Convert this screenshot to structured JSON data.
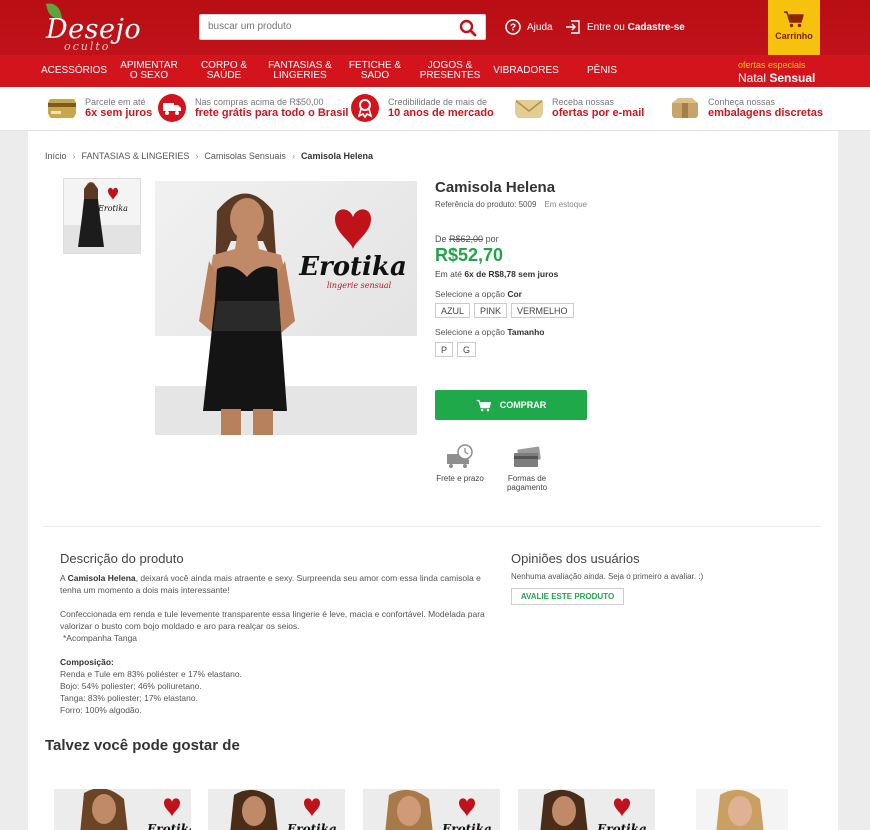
{
  "header": {
    "logo_text": "Desejo",
    "logo_sub": "oculto",
    "search_placeholder": "buscar um produto",
    "help_label": "Ajuda",
    "login_prefix": "Entre ou",
    "login_signup": "Cadastre-se",
    "cart_label": "Carrinho"
  },
  "nav": {
    "items": [
      "ACESSÓRIOS",
      "APIMENTAR O SEXO",
      "CORPO & SAÚDE",
      "FANTASIAS & LINGERIES",
      "FETICHE & SADO",
      "JOGOS & PRESENTES",
      "VIBRADORES",
      "PÊNIS"
    ],
    "promo_small": "ofertas especiais",
    "promo_big_a": "Natal",
    "promo_big_b": "Sensual"
  },
  "benefits": [
    {
      "line1": "Parcele em até",
      "line2": "6x sem juros",
      "icon": "card-icon"
    },
    {
      "line1": "Nas compras acima de R$50,00",
      "line2": "frete grátis para todo o Brasil",
      "icon": "truck-icon"
    },
    {
      "line1": "Credibilidade de mais de",
      "line2": "10 anos de mercado",
      "icon": "badge-icon"
    },
    {
      "line1": "Receba nossas",
      "line2": "ofertas por e-mail",
      "icon": "envelope-icon"
    },
    {
      "line1": "Conheça nossas",
      "line2": "embalagens discretas",
      "icon": "package-icon"
    }
  ],
  "breadcrumb": [
    "Início",
    "FANTASIAS & LINGERIES",
    "Camisolas Sensuais",
    "Camisola Helena"
  ],
  "product": {
    "title": "Camisola Helena",
    "ref_label": "Referência do produto: 5009",
    "stock": "Em estoque",
    "price_from_label": "De",
    "price_old": "R$62,00",
    "price_by": "por",
    "price_now": "R$52,70",
    "installments_prefix": "Em até",
    "installments_value": "6x de R$8,78 sem juros",
    "color_label": "Selecione a opção",
    "color_name": "Cor",
    "colors": [
      "AZUL",
      "PINK",
      "VERMELHO"
    ],
    "size_label": "Selecione a opção",
    "size_name": "Tamanho",
    "sizes": [
      "P",
      "G"
    ],
    "buy_label": "COMPRAR",
    "shipping_label": "Frete e prazo",
    "payment_label": "Formas de pagamento",
    "brand_logo_text": "Erotika",
    "brand_logo_sub": "lingerie sensual"
  },
  "description": {
    "title": "Descrição do produto",
    "p1_prefix": "A",
    "p1_name": "Camisola Helena",
    "p1_rest": ", deixará você ainda mais atraente e sexy. Surpreenda seu amor com essa linda camisola e tenha um momento a dois mais interessante!",
    "p2": "Confeccionada em renda e tule levemente transparente essa lingerie é leve, macia e confortável.  Modelada para valorizar o busto com bojo moldado e aro para realçar os seios.",
    "p3": "*Acompanha Tanga",
    "comp_title": "Composição:",
    "comp_lines": [
      "Renda e Tule em 83% poliéster e 17% elastano.",
      "Bojo: 54% poliester; 46% poliuretano.",
      "Tanga: 83% poliester; 17% elastano.",
      "Forro: 100% algodão."
    ]
  },
  "opinions": {
    "title": "Opiniões dos usuários",
    "text": "Nenhuma avaliação ainda. Seja o primeiro a avaliar. :)",
    "button": "AVALIE ESTE PRODUTO"
  },
  "suggestions": {
    "title": "Talvez você pode gostar de"
  },
  "colors": {
    "header_red": "#b90e14",
    "nav_red": "#d4141d",
    "cart_yellow": "#f7c20d",
    "price_green": "#22a447",
    "buy_green": "#1fa94a"
  }
}
